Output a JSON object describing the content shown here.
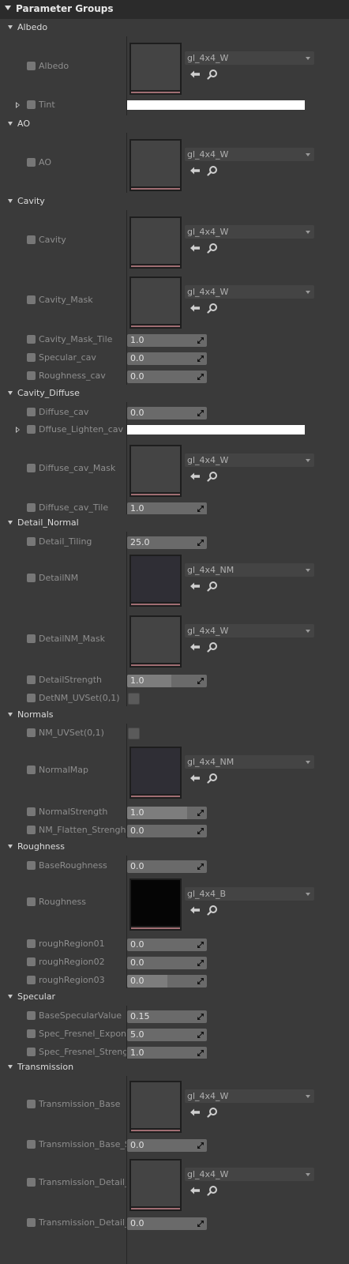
{
  "panel": {
    "title": "Parameter Groups"
  },
  "groups": {
    "albedo": "Albedo",
    "ao": "AO",
    "cavity": "Cavity",
    "cavity_diffuse": "Cavity_Diffuse",
    "detail_normal": "Detail_Normal",
    "normals": "Normals",
    "roughness": "Roughness",
    "specular": "Specular",
    "transmission": "Transmission"
  },
  "params": {
    "albedo": {
      "label": "Albedo",
      "texture": "gl_4x4_W"
    },
    "tint": {
      "label": "Tint",
      "color": "#ffffff"
    },
    "ao": {
      "label": "AO",
      "texture": "gl_4x4_W"
    },
    "cavity": {
      "label": "Cavity",
      "texture": "gl_4x4_W"
    },
    "cavity_mask": {
      "label": "Cavity_Mask",
      "texture": "gl_4x4_W"
    },
    "cavity_mask_tile": {
      "label": "Cavity_Mask_Tile",
      "value": "1.0"
    },
    "specular_cav": {
      "label": "Specular_cav",
      "value": "0.0"
    },
    "roughness_cav": {
      "label": "Roughness_cav",
      "value": "0.0"
    },
    "diffuse_cav": {
      "label": "Diffuse_cav",
      "value": "0.0"
    },
    "diffuse_lighten_cav": {
      "label": "Dffuse_Lighten_cav",
      "color": "#ffffff"
    },
    "diffuse_cav_mask": {
      "label": "Diffuse_cav_Mask",
      "texture": "gl_4x4_W"
    },
    "diffuse_cav_tile": {
      "label": "Diffuse_cav_Tile",
      "value": "1.0"
    },
    "detail_tiling": {
      "label": "Detail_Tiling",
      "value": "25.0"
    },
    "detail_nm": {
      "label": "DetailNM",
      "texture": "gl_4x4_NM"
    },
    "detail_nm_mask": {
      "label": "DetailNM_Mask",
      "texture": "gl_4x4_W"
    },
    "detail_strength": {
      "label": "DetailStrength",
      "value": "1.0",
      "slider_fraction": 0.55
    },
    "detnm_uvset": {
      "label": "DetNM_UVSet(0,1)"
    },
    "nm_uvset": {
      "label": "NM_UVSet(0,1)"
    },
    "normal_map": {
      "label": "NormalMap",
      "texture": "gl_4x4_NM"
    },
    "normal_strength": {
      "label": "NormalStrength",
      "value": "1.0",
      "slider_fraction": 0.75
    },
    "nm_flatten": {
      "label": "NM_Flatten_Strengh",
      "value": "0.0"
    },
    "base_roughness": {
      "label": "BaseRoughness",
      "value": "0.0"
    },
    "roughness": {
      "label": "Roughness",
      "texture": "gl_4x4_B"
    },
    "rough_region01": {
      "label": "roughRegion01",
      "value": "0.0"
    },
    "rough_region02": {
      "label": "roughRegion02",
      "value": "0.0"
    },
    "rough_region03": {
      "label": "roughRegion03",
      "value": "0.0",
      "slider_fraction": 0.5
    },
    "base_specular": {
      "label": "BaseSpecularValue",
      "value": "0.15"
    },
    "spec_fresnel_exp": {
      "label": "Spec_Fresnel_Exponen",
      "value": "5.0"
    },
    "spec_fresnel_str": {
      "label": "Spec_Fresnel_Strengh",
      "value": "1.0"
    },
    "transmission_base": {
      "label": "Transmission_Base",
      "texture": "gl_4x4_W"
    },
    "transmission_base_s": {
      "label": "Transmission_Base_St",
      "value": "0.0"
    },
    "transmission_detail_m": {
      "label": "Transmission_Detail_M",
      "texture": "gl_4x4_W"
    },
    "transmission_detail_s": {
      "label": "Transmission_Detail_S",
      "value": "0.0"
    }
  }
}
